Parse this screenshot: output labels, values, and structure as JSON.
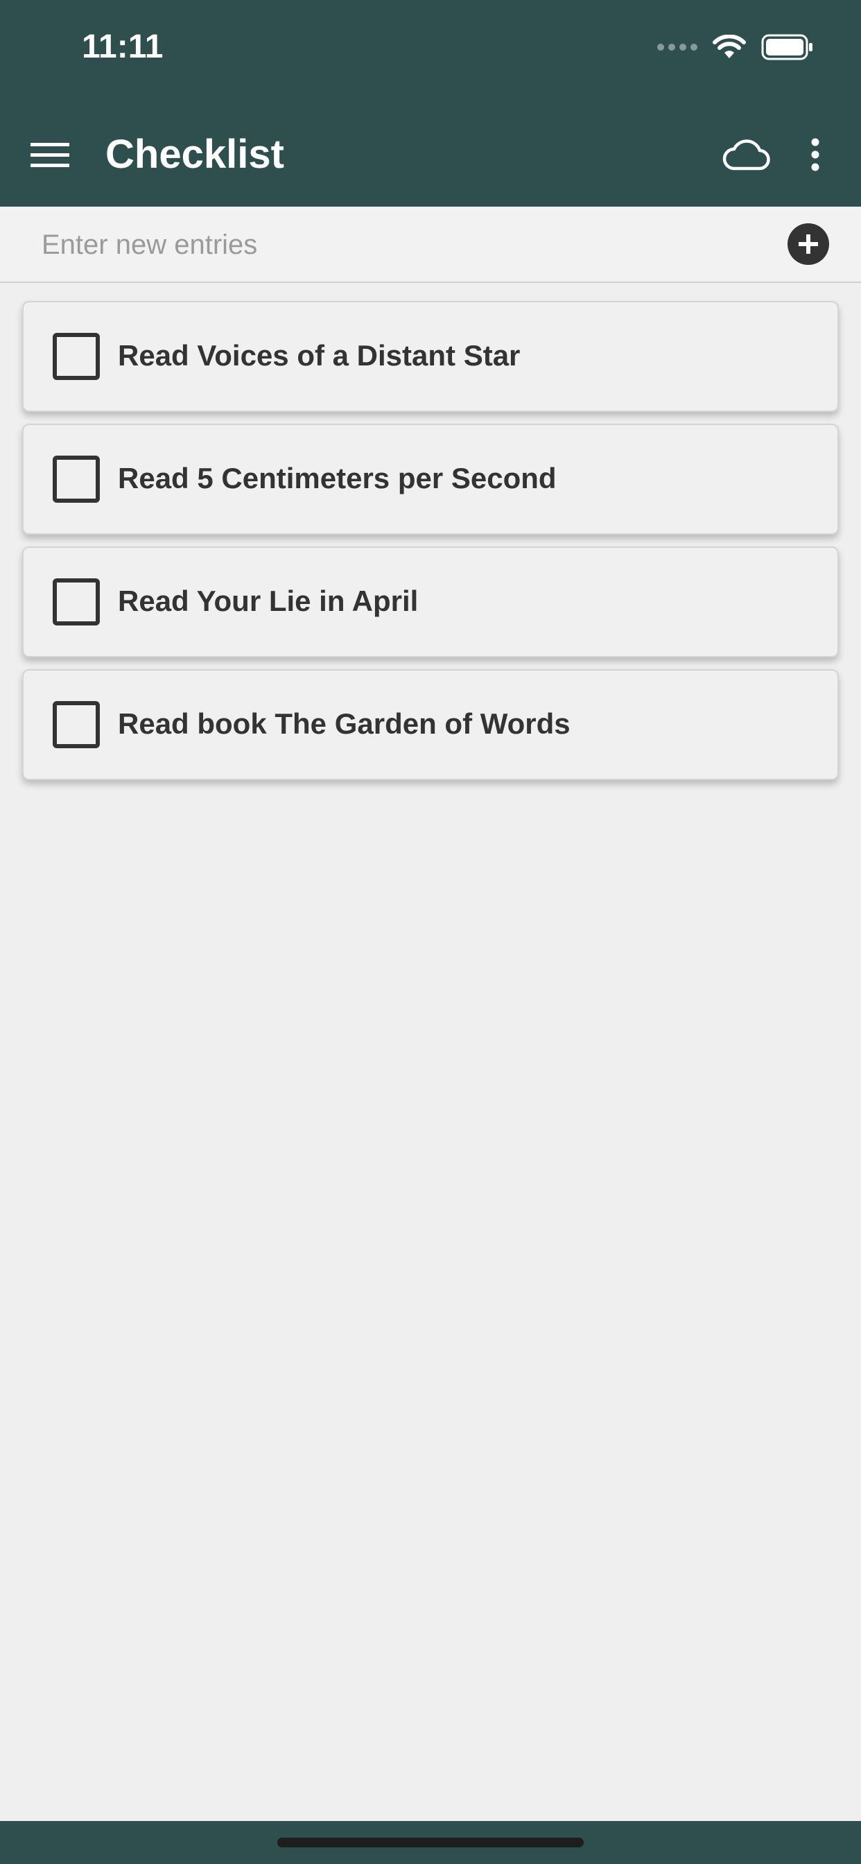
{
  "status_bar": {
    "time": "11:11"
  },
  "toolbar": {
    "title": "Checklist",
    "menu_icon": "hamburger-menu-icon",
    "cloud_icon": "cloud-icon",
    "more_icon": "more-vertical-icon"
  },
  "entry": {
    "placeholder": "Enter new entries",
    "value": "",
    "add_icon": "plus-circle-icon"
  },
  "items": [
    {
      "label": "Read Voices of a Distant Star",
      "checked": false
    },
    {
      "label": "Read 5 Centimeters per Second",
      "checked": false
    },
    {
      "label": "Read Your Lie in April",
      "checked": false
    },
    {
      "label": "Read book The Garden of Words",
      "checked": false
    }
  ],
  "colors": {
    "header_bg": "#2f4f4f",
    "page_bg": "#efefef",
    "text_dark": "#333333",
    "placeholder": "#9a9a9a"
  }
}
